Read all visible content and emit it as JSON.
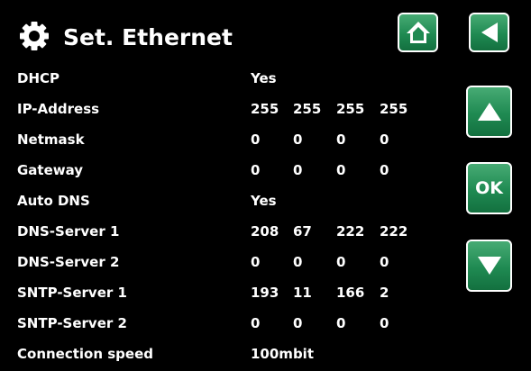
{
  "header": {
    "title": "Set. Ethernet",
    "icon": "gear-icon"
  },
  "buttons": {
    "home_icon": "home-icon",
    "back_icon": "back-arrow-icon",
    "up_icon": "arrow-up-icon",
    "ok_label": "OK",
    "down_icon": "arrow-down-icon"
  },
  "colors": {
    "background": "#000000",
    "text": "#ffffff",
    "button_green": "#1f8a52",
    "button_border": "#ffffff"
  },
  "settings": [
    {
      "label": "DHCP",
      "values": [
        "Yes"
      ]
    },
    {
      "label": "IP-Address",
      "values": [
        "255",
        "255",
        "255",
        "255"
      ]
    },
    {
      "label": "Netmask",
      "values": [
        "0",
        "0",
        "0",
        "0"
      ]
    },
    {
      "label": "Gateway",
      "values": [
        "0",
        "0",
        "0",
        "0"
      ]
    },
    {
      "label": "Auto DNS",
      "values": [
        "Yes"
      ]
    },
    {
      "label": "DNS-Server 1",
      "values": [
        "208",
        "67",
        "222",
        "222"
      ]
    },
    {
      "label": "DNS-Server 2",
      "values": [
        "0",
        "0",
        "0",
        "0"
      ]
    },
    {
      "label": "SNTP-Server 1",
      "values": [
        "193",
        "11",
        "166",
        "2"
      ]
    },
    {
      "label": "SNTP-Server 2",
      "values": [
        "0",
        "0",
        "0",
        "0"
      ]
    },
    {
      "label": "Connection speed",
      "values": [
        "100mbit"
      ]
    }
  ]
}
